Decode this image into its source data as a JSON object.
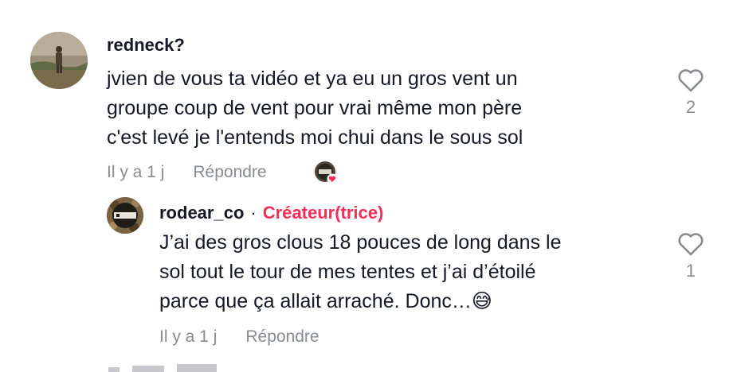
{
  "comment": {
    "username": "redneck?",
    "text_lines": [
      "jvien de vous ta vidéo et ya eu un gros vent un",
      "groupe coup de vent pour vrai même mon père",
      "c'est levé je l'entends moi chui dans le sous sol"
    ],
    "time": "Il y a 1 j",
    "reply_label": "Répondre",
    "like_count": "2",
    "icons": {
      "like": "heart-outline-icon",
      "creator_liked": "creator-liked-badge-icon"
    }
  },
  "reply": {
    "username": "rodear_co",
    "separator": "·",
    "creator_label": "Créateur(trice)",
    "text_lines": [
      "J’ai des gros clous 18 pouces de long dans le",
      "sol tout le tour de mes tentes et j’ai d’étoilé",
      "parce que ça allait arraché. Donc…"
    ],
    "emoji": "😅",
    "time": "Il y a 1 j",
    "reply_label": "Répondre",
    "like_count": "1",
    "icons": {
      "like": "heart-outline-icon"
    }
  },
  "colors": {
    "accent": "#fe2c55",
    "muted": "#8a8b91",
    "text": "#161823"
  }
}
